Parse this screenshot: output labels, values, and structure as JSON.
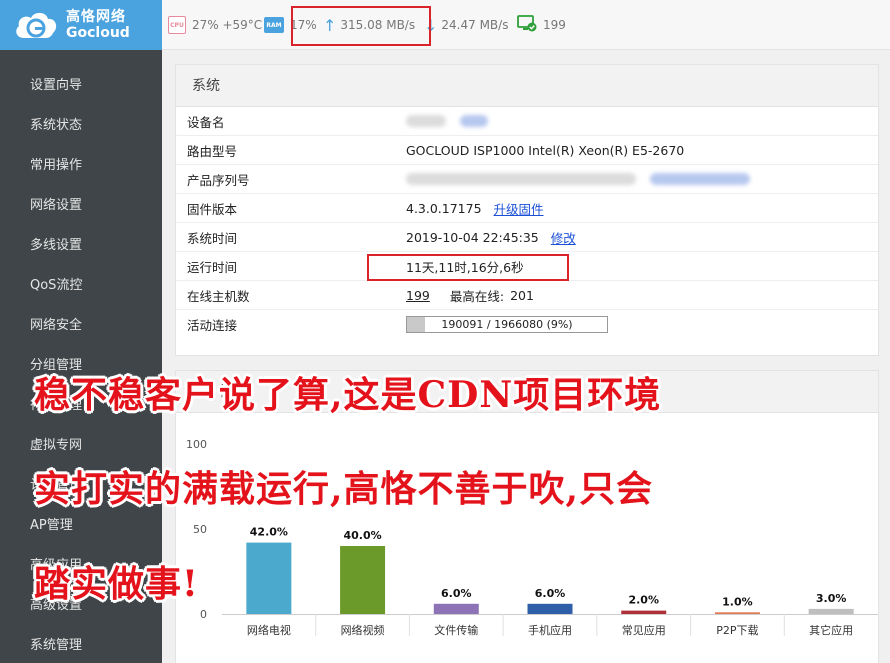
{
  "brand": {
    "cn": "高恪网络",
    "en": "Gocloud",
    "accent": "#4aa3df"
  },
  "topbar": {
    "cpu_chip": "CPU",
    "cpu_text": "27% +59°C",
    "ram_chip": "RAM",
    "ram_text": "17%",
    "up_arrow": "↑",
    "up_text": "315.08 MB/s",
    "down_arrow": "↓",
    "down_text": "24.47 MB/s",
    "hosts_text": "199"
  },
  "sidebar": {
    "items": [
      {
        "label": "设置向导"
      },
      {
        "label": "系统状态"
      },
      {
        "label": "常用操作"
      },
      {
        "label": "网络设置"
      },
      {
        "label": "多线设置"
      },
      {
        "label": "QoS流控"
      },
      {
        "label": "网络安全"
      },
      {
        "label": "分组管理"
      },
      {
        "label": "行为管理"
      },
      {
        "label": "虚拟专网"
      },
      {
        "label": "认证管理"
      },
      {
        "label": "AP管理"
      },
      {
        "label": "高级应用"
      },
      {
        "label": "高级设置"
      },
      {
        "label": "系统管理"
      }
    ]
  },
  "system": {
    "title": "系统",
    "rows": {
      "device_name_key": "设备名",
      "model_key": "路由型号",
      "model_value": "GOCLOUD ISP1000 Intel(R) Xeon(R) E5-2670",
      "serial_key": "产品序列号",
      "firmware_key": "固件版本",
      "firmware_value": "4.3.0.17175",
      "firmware_link": "升级固件",
      "time_key": "系统时间",
      "time_value": "2019-10-04 22:45:35",
      "time_link": "修改",
      "uptime_key": "运行时间",
      "uptime_value": "11天,11时,16分,6秒",
      "hosts_key": "在线主机数",
      "hosts_value": "199",
      "hosts_peak_label": "最高在线:",
      "hosts_peak_value": "201",
      "conn_key": "活动连接",
      "conn_text": "190091 / 1966080 (9%)",
      "conn_fraction": 0.09
    }
  },
  "chart_panel": {
    "title_visible": "比例"
  },
  "chart_data": {
    "type": "bar",
    "title": "",
    "categories": [
      "网络电视",
      "网络视频",
      "文件传输",
      "手机应用",
      "常见应用",
      "P2P下载",
      "其它应用"
    ],
    "values": [
      42.0,
      40.0,
      6.0,
      6.0,
      2.0,
      1.0,
      3.0
    ],
    "labels": [
      "42.0%",
      "40.0%",
      "6.0%",
      "6.0%",
      "2.0%",
      "1.0%",
      "3.0%"
    ],
    "colors": [
      "#4aa9cc",
      "#6b9a2a",
      "#8d72b6",
      "#2f5fa8",
      "#b0303a",
      "#e07a55",
      "#bfbfbf"
    ],
    "yticks": [
      "0",
      "50",
      "100"
    ],
    "ylim": [
      0,
      100
    ],
    "grid": false
  },
  "overlay": {
    "line1": "稳不稳客户说了算,这是CDN项目环境",
    "line2": "实打实的满载运行,高恪不善于吹,只会",
    "line3": "踏实做事!"
  }
}
